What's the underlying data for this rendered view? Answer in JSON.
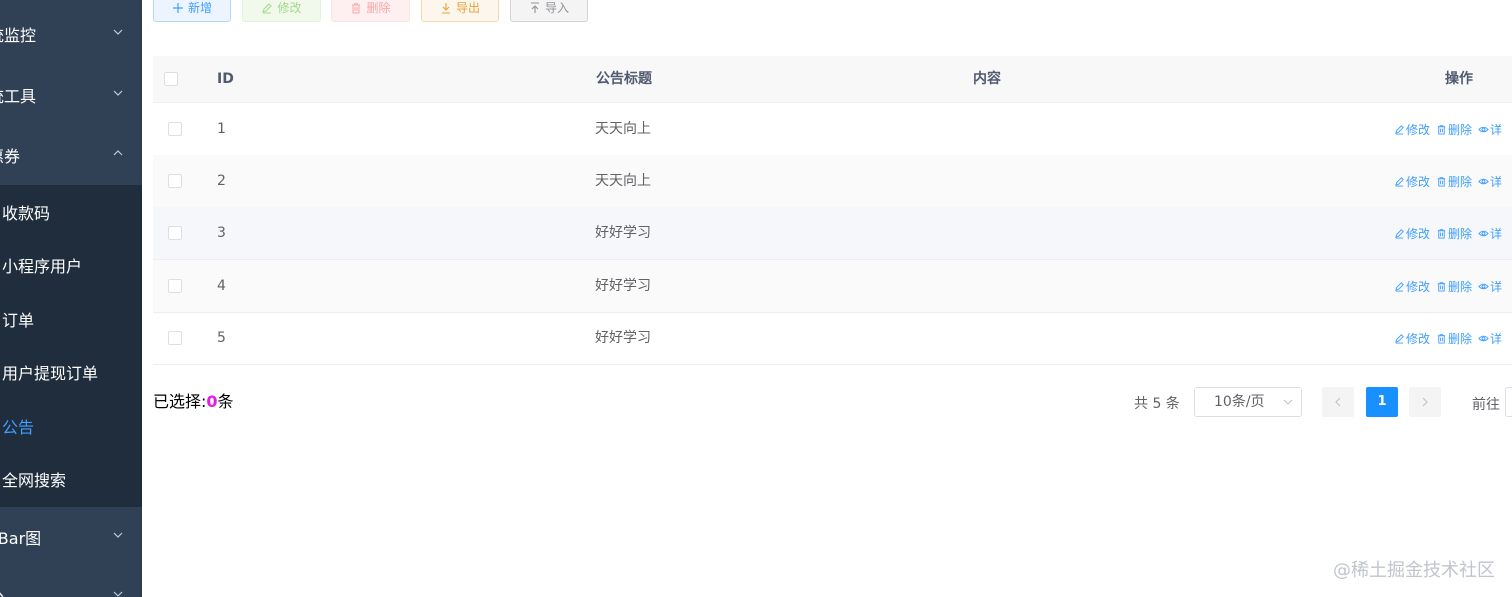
{
  "sidebar": {
    "menus_top": [
      {
        "label": "统监控"
      },
      {
        "label": "统工具"
      },
      {
        "label": "惠券"
      }
    ],
    "submenu": [
      {
        "label": "收款码"
      },
      {
        "label": "小程序用户"
      },
      {
        "label": "订单"
      },
      {
        "label": "用户提现订单"
      },
      {
        "label": "公告",
        "active": true
      },
      {
        "label": "全网搜索"
      }
    ],
    "menus_bottom": [
      {
        "label": "oBar图"
      },
      {
        "label": "公"
      }
    ]
  },
  "toolbar": {
    "add_label": "新增",
    "edit_label": "修改",
    "delete_label": "删除",
    "export_label": "导出",
    "import_label": "导入"
  },
  "table": {
    "columns": {
      "id": "ID",
      "title": "公告标题",
      "content": "内容",
      "ops": "操作"
    },
    "rows": [
      {
        "id": "1",
        "title": "天天向上",
        "content": ""
      },
      {
        "id": "2",
        "title": "天天向上",
        "content": ""
      },
      {
        "id": "3",
        "title": "好好学习",
        "content": ""
      },
      {
        "id": "4",
        "title": "好好学习",
        "content": ""
      },
      {
        "id": "5",
        "title": "好好学习",
        "content": ""
      }
    ],
    "row_ops": {
      "edit": "修改",
      "delete": "删除",
      "detail": "详"
    }
  },
  "footer": {
    "selected_prefix": "已选择:",
    "selected_count": "0",
    "selected_suffix": "条",
    "total": "共 5 条",
    "page_size": "10条/页",
    "current_page": "1",
    "goto_label": "前往"
  },
  "watermark": "@稀土掘金技术社区",
  "colors": {
    "sidebar_bg": "#304156",
    "submenu_bg": "#1f2d3d",
    "accent": "#409eff",
    "pager_active": "#1890ff",
    "selected_count": "#e619e6"
  }
}
